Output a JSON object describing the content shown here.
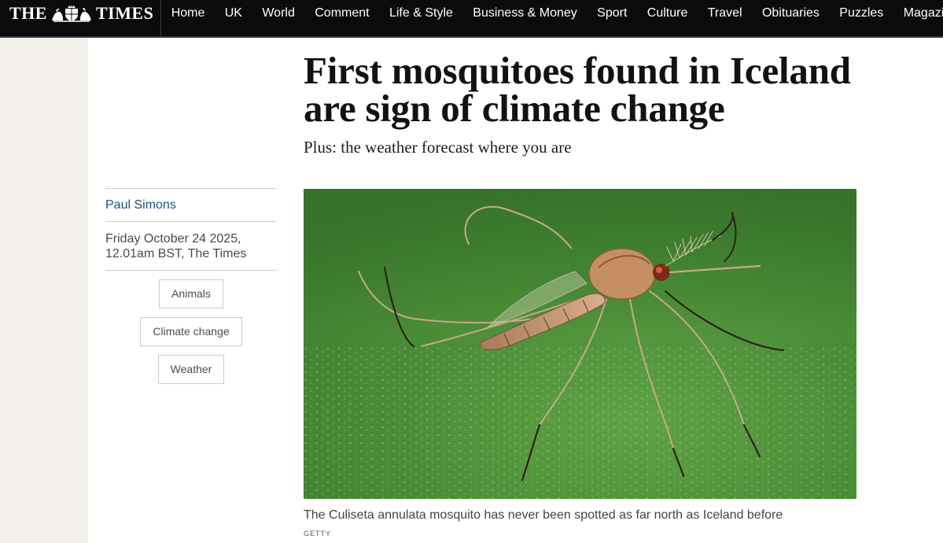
{
  "masthead": {
    "logo_left": "THE",
    "logo_right": "TIMES",
    "crest_icon": "royal-crest-icon"
  },
  "nav": {
    "items": [
      {
        "label": "Home"
      },
      {
        "label": "UK"
      },
      {
        "label": "World"
      },
      {
        "label": "Comment"
      },
      {
        "label": "Life & Style"
      },
      {
        "label": "Business & Money"
      },
      {
        "label": "Sport"
      },
      {
        "label": "Culture"
      },
      {
        "label": "Travel"
      },
      {
        "label": "Obituaries"
      },
      {
        "label": "Puzzles"
      },
      {
        "label": "Magazines"
      }
    ]
  },
  "article": {
    "headline": "First mosquitoes found in Iceland are sign of climate change",
    "standfirst": "Plus: the weather forecast where you are",
    "author": "Paul Simons",
    "dateline": "Friday October 24 2025, 12.01am BST, The Times",
    "tags": [
      {
        "label": "Animals"
      },
      {
        "label": "Climate change"
      },
      {
        "label": "Weather"
      }
    ],
    "image": {
      "caption": "The Culiseta annulata mosquito has never been spotted as far north as Iceland before",
      "credit": "GETTY"
    }
  },
  "colors": {
    "nav_background": "#0b0b0d",
    "gutter": "#f2eeea",
    "author_link": "#1f4e85",
    "leaf_green": "#4a8a35"
  }
}
